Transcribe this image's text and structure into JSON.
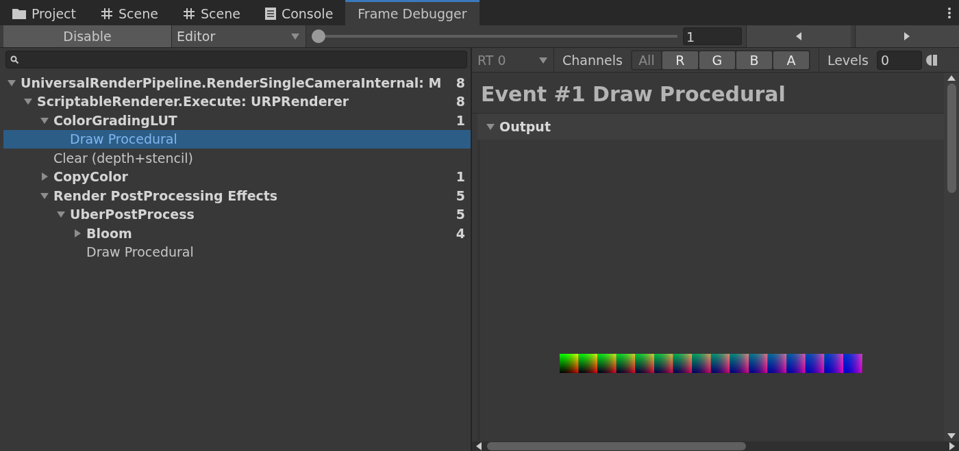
{
  "tabs": [
    {
      "label": "Project",
      "kind": "folder",
      "selected": false
    },
    {
      "label": "Scene",
      "kind": "grid",
      "selected": false
    },
    {
      "label": "Scene",
      "kind": "grid",
      "selected": false
    },
    {
      "label": "Console",
      "kind": "console",
      "selected": false
    },
    {
      "label": "Frame Debugger",
      "kind": "plain",
      "selected": true
    }
  ],
  "toolbar": {
    "disable_button": "Disable",
    "target_dropdown": "Editor",
    "event_slider": {
      "level": 0
    },
    "event_field": "1"
  },
  "tree": [
    {
      "label": "UniversalRenderPipeline.RenderSingleCameraInternal: M",
      "count": "8",
      "expanded": true,
      "selected": false,
      "children": [
        {
          "label": "ScriptableRenderer.Execute: URPRenderer",
          "count": "8",
          "expanded": true,
          "selected": false,
          "children": [
            {
              "label": "ColorGradingLUT",
              "count": "1",
              "expanded": true,
              "selected": false,
              "children": [
                {
                  "label": "Draw Procedural",
                  "selected": true
                }
              ]
            },
            {
              "label": "Clear (depth+stencil)",
              "selected": false
            },
            {
              "label": "CopyColor",
              "count": "1",
              "expanded": false,
              "selected": false
            },
            {
              "label": "Render PostProcessing Effects",
              "count": "5",
              "expanded": true,
              "selected": false,
              "children": [
                {
                  "label": "UberPostProcess",
                  "count": "5",
                  "expanded": true,
                  "selected": false,
                  "children": [
                    {
                      "label": "Bloom",
                      "count": "4",
                      "expanded": false,
                      "selected": false
                    },
                    {
                      "label": "Draw Procedural",
                      "selected": false
                    }
                  ]
                }
              ]
            }
          ]
        }
      ]
    }
  ],
  "details": {
    "rt_dropdown": "RT 0",
    "channels_label": "Channels",
    "channels": [
      {
        "label": "All",
        "selected": false
      },
      {
        "label": "R",
        "selected": true
      },
      {
        "label": "G",
        "selected": true
      },
      {
        "label": "B",
        "selected": true
      },
      {
        "label": "A",
        "selected": true
      }
    ],
    "levels_label": "Levels",
    "levels_field": "0",
    "title": "Event #1 Draw Procedural",
    "output_section": {
      "label": "Output",
      "expanded": true
    }
  }
}
